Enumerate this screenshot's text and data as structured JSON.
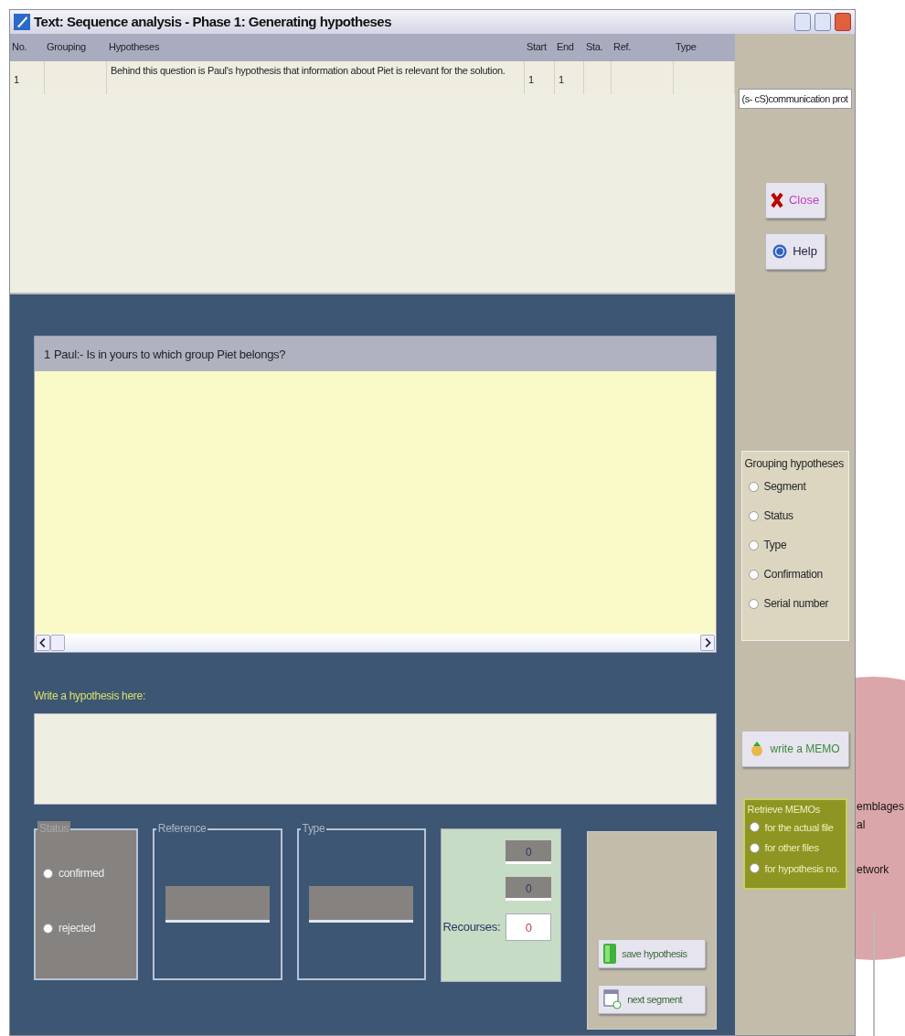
{
  "window": {
    "title": "Text: Sequence analysis - Phase 1: Generating hypotheses"
  },
  "table": {
    "columns": [
      "No.",
      "Grouping",
      "Hypotheses",
      "Start",
      "End",
      "Sta.",
      "Ref.",
      "Type"
    ],
    "rows": [
      [
        "1",
        "",
        "Behind this question is Paul's hypothesis that information about Piet is relevant for the solution.",
        "1",
        "1",
        "",
        "",
        ""
      ]
    ]
  },
  "segment": {
    "number": "1",
    "text": "Paul:- Is in yours to which group Piet belongs?"
  },
  "hypothesis_label": "Write a hypothesis here:",
  "status_group": {
    "title": "Status",
    "disabled": true,
    "options": [
      {
        "label": "confirmed",
        "selected": false
      },
      {
        "label": "rejected",
        "selected": false
      }
    ]
  },
  "reference_group": {
    "title": "Reference"
  },
  "type_group": {
    "title": "Type"
  },
  "counters": {
    "values": [
      "0",
      "0"
    ],
    "recourses_label": "Recourses:",
    "recourses_value": "0"
  },
  "action_buttons": [
    {
      "kind": "save",
      "label": "save hypothesis"
    },
    {
      "kind": "next",
      "label": "next segment"
    }
  ],
  "side": {
    "file_field": "(s- cS)communication prot",
    "buttons": [
      {
        "kind": "close",
        "label": "Close"
      },
      {
        "kind": "help",
        "label": "Help"
      }
    ],
    "grouping": {
      "title": "Grouping hypotheses",
      "options": [
        {
          "label": "Segment",
          "selected": false
        },
        {
          "label": "Status",
          "selected": false
        },
        {
          "label": "Type",
          "selected": false
        },
        {
          "label": "Confirmation",
          "selected": false
        },
        {
          "label": "Serial number",
          "selected": false
        }
      ]
    },
    "memo_button": "write a MEMO",
    "retrieve": {
      "title": "Retrieve MEMOs",
      "options": [
        {
          "label": "for the actual file",
          "selected": false
        },
        {
          "label": "for other files",
          "selected": false
        },
        {
          "label": "for hypothesis no.",
          "selected": false
        }
      ]
    }
  },
  "background_texts": [
    "emblages",
    "al",
    "etwork"
  ]
}
